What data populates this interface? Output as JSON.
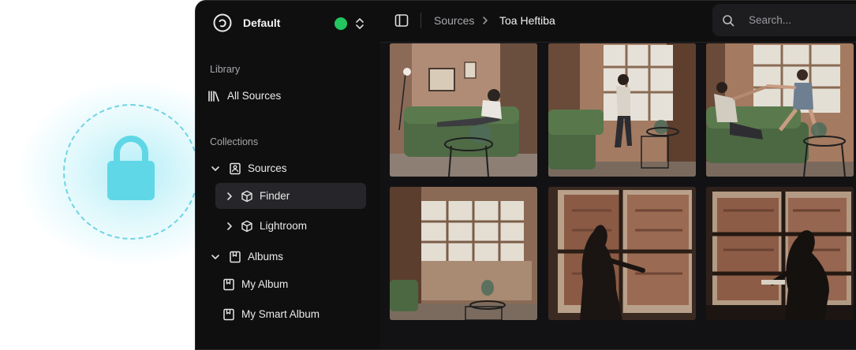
{
  "workspace": {
    "name": "Default",
    "status_color": "#22c55e"
  },
  "sidebar": {
    "library_label": "Library",
    "library_items": [
      {
        "label": "All Sources",
        "icon": "library-icon"
      }
    ],
    "collections_label": "Collections",
    "sources": {
      "label": "Sources",
      "icon": "image-frame-icon",
      "expanded": true,
      "children": [
        {
          "label": "Finder",
          "icon": "cube-icon",
          "active": true
        },
        {
          "label": "Lightroom",
          "icon": "cube-icon",
          "active": false
        }
      ]
    },
    "albums": {
      "label": "Albums",
      "icon": "album-icon",
      "expanded": true,
      "children": [
        {
          "label": "My Album",
          "icon": "album-icon"
        },
        {
          "label": "My Smart Album",
          "icon": "album-icon"
        }
      ]
    }
  },
  "topbar": {
    "breadcrumb": [
      "Sources",
      "Toa Heftiba"
    ],
    "search_placeholder": "Search..."
  },
  "colors": {
    "accent_cyan": "#6fd3e4",
    "lock": "#5fd7e6",
    "sofa_green": "#4f6b45"
  }
}
